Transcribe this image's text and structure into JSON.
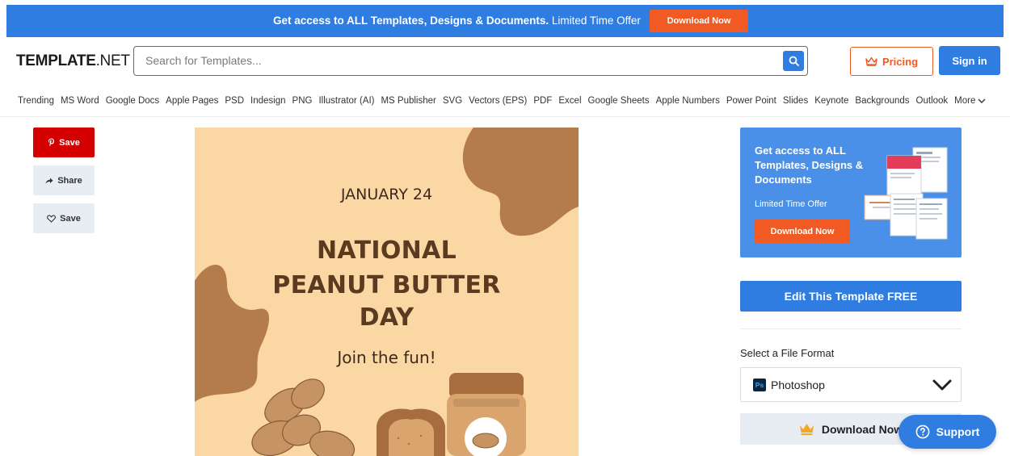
{
  "promo": {
    "text_bold": "Get access to ALL Templates, Designs & Documents.",
    "text_rest": " Limited Time Offer",
    "button": "Download Now"
  },
  "header": {
    "logo_bold": "TEMPLATE",
    "logo_rest": ".NET",
    "search_placeholder": "Search for Templates...",
    "pricing": "Pricing",
    "signin": "Sign in"
  },
  "categories": [
    "Trending",
    "MS Word",
    "Google Docs",
    "Apple Pages",
    "PSD",
    "Indesign",
    "PNG",
    "Illustrator (AI)",
    "MS Publisher",
    "SVG",
    "Vectors (EPS)",
    "PDF",
    "Excel",
    "Google Sheets",
    "Apple Numbers",
    "Power Point",
    "Slides",
    "Keynote",
    "Backgrounds",
    "Outlook"
  ],
  "more_label": "More",
  "share": {
    "pin_save": "Save",
    "share": "Share",
    "fav_save": "Save"
  },
  "preview": {
    "date": "JANUARY 24",
    "title_line1": "NATIONAL",
    "title_line2": "PEANUT BUTTER",
    "title_line3": "DAY",
    "subtitle": "Join the fun!"
  },
  "ad": {
    "headline": "Get access to ALL Templates, Designs & Documents",
    "sub": "Limited Time Offer",
    "button": "Download Now"
  },
  "sidebar": {
    "edit_button": "Edit This Template FREE",
    "format_label": "Select a File Format",
    "format_value": "Photoshop",
    "format_icon_text": "Ps",
    "download_button": "Download Now",
    "support_button": "Support"
  },
  "colors": {
    "accent_blue": "#2f7de1",
    "accent_orange": "#f15a22",
    "pinterest_red": "#d40000",
    "preview_bg": "#fad7a3",
    "preview_brown": "#5b3a22"
  }
}
